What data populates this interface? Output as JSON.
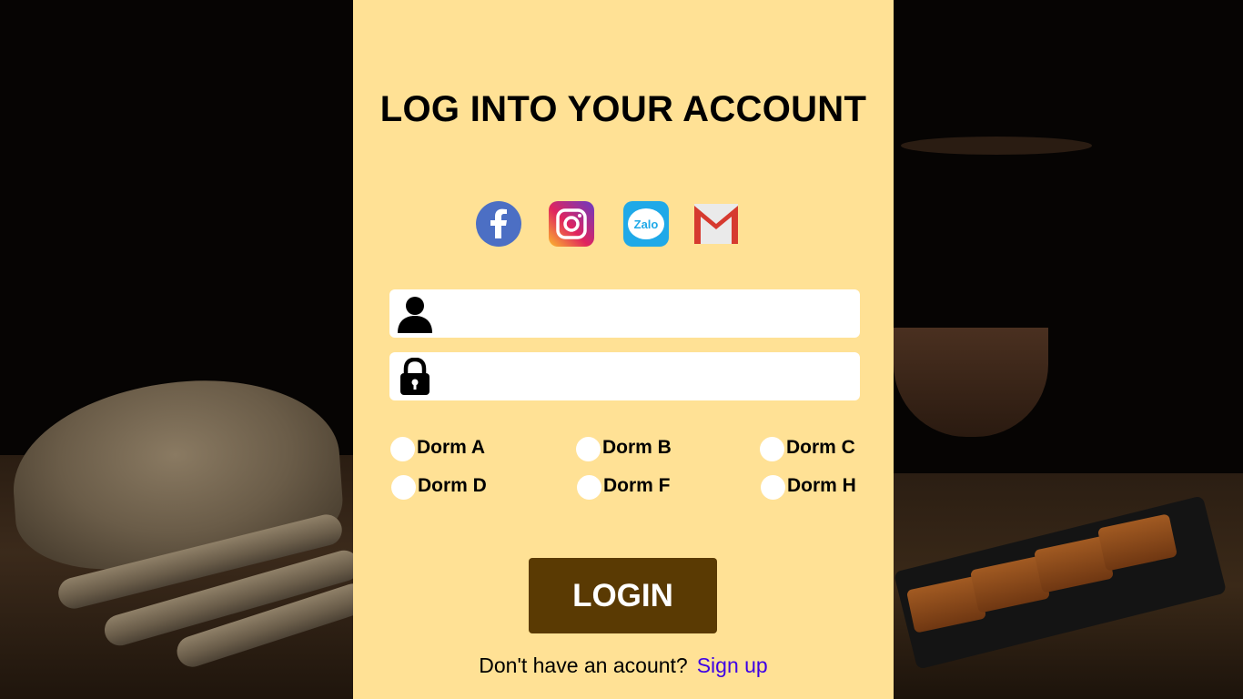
{
  "page": {
    "title": "LOG INTO YOUR ACCOUNT",
    "panel_color": "#ffe195"
  },
  "social": [
    {
      "name": "facebook-icon",
      "label": "f",
      "color": "#4c6fc4"
    },
    {
      "name": "instagram-icon",
      "color": "#d6249f"
    },
    {
      "name": "zalo-icon",
      "label": "Zalo",
      "color": "#1fa9e8"
    },
    {
      "name": "gmail-icon",
      "color": "#d63a2f"
    }
  ],
  "form": {
    "username": {
      "icon": "user-icon",
      "value": "",
      "placeholder": ""
    },
    "password": {
      "icon": "lock-icon",
      "value": "",
      "placeholder": ""
    },
    "dorms": [
      "Dorm A",
      "Dorm B",
      "Dorm C",
      "Dorm D",
      "Dorm F",
      "Dorm H"
    ]
  },
  "actions": {
    "login_label": "LOGIN",
    "login_color": "#5a3a03",
    "signup_prompt": "Don't have an acount?",
    "signup_label": "Sign up",
    "signup_color": "#3d00e6"
  }
}
